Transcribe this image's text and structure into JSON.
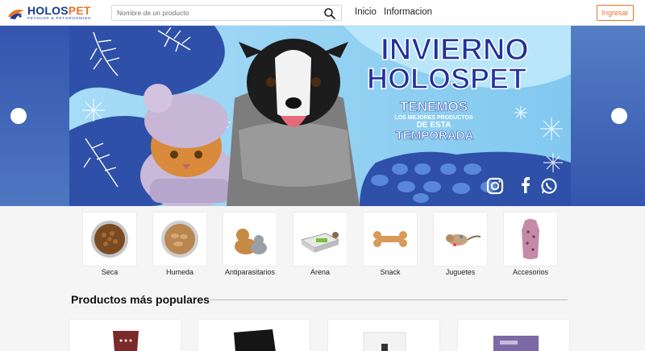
{
  "header": {
    "logo_name_part1": "HOLOS",
    "logo_name_part2": "PET",
    "logo_tagline": "PETSHOP & PETGROOMING",
    "search_placeholder": "Nombre de un producto",
    "nav_inicio": "Inicio",
    "nav_informacion": "Informacion",
    "login_label": "Ingresar"
  },
  "banner": {
    "headline_line1": "INVIERNO",
    "headline_line2": "HOLOSPET",
    "sub_line1": "TENEMOS",
    "sub_line2": "LOS MEJORES PRODUCTOS",
    "sub_line3": "DE ESTA",
    "sub_line4": "TEMPORADA"
  },
  "categories": [
    {
      "label": "Seca",
      "icon": "dry-food-bowl-icon"
    },
    {
      "label": "Humeda",
      "icon": "wet-food-bowl-icon"
    },
    {
      "label": "Antiparasitarios",
      "icon": "pets-icon"
    },
    {
      "label": "Arena",
      "icon": "litter-box-icon"
    },
    {
      "label": "Snack",
      "icon": "bone-icon"
    },
    {
      "label": "Juguetes",
      "icon": "toy-icon"
    },
    {
      "label": "Accesorios",
      "icon": "clothing-icon"
    }
  ],
  "popular": {
    "title": "Productos más populares"
  },
  "colors": {
    "brand_blue": "#1b3a8f",
    "brand_orange": "#e8732a",
    "banner_blue": "#2e50a8",
    "banner_light": "#8fd0f2"
  }
}
